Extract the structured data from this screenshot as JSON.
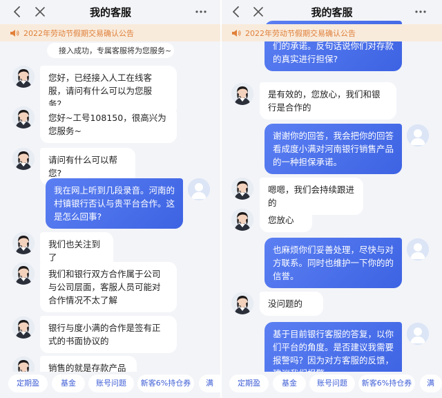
{
  "left": {
    "title": "我的客服",
    "notice": "2022年劳动节假期交易确认公告",
    "system_message": "接入成功，专属客服将为您服务~",
    "messages": [
      {
        "text": "您好，已经接入人工在线客服，请问有什么可以为您服务？"
      },
      {
        "text": "您好~工号108150，很高兴为您服务~"
      },
      {
        "text": "请问有什么可以帮您?"
      },
      {
        "text": "我在网上听到几段录音。河南的村镇银行否认与贵平台合作。这是怎么回事?"
      },
      {
        "text": "我们也关注到了"
      },
      {
        "text": "我们和银行双方合作属于公司与公司层面，客服人员可能对合作情况不太了解"
      },
      {
        "text": "银行与度小满的合作是签有正式的书面协议的"
      },
      {
        "text": "销售的就是存款产品的"
      }
    ],
    "chips": [
      "定期盈",
      "基金",
      "账号问题",
      "新客6%持仓券",
      "满"
    ]
  },
  "right": {
    "title": "我的客服",
    "notice": "2022年劳动节假期交易确认公告",
    "messages": [
      {
        "text": "保险保障是否有效，是否就是你们的承诺。反句话说你们对存款的真实进行担保?"
      },
      {
        "text": "是有效的，您放心，我们和银行是合作的"
      },
      {
        "text": "谢谢你的回答，我会把你的回答看成度小满对河南银行销售产品的一种担保承诺。"
      },
      {
        "text": "嗯嗯，我们会持续跟进的"
      },
      {
        "text": "您放心"
      },
      {
        "text": "也麻烦你们妥善处理，尽快与对方联系。同时也维护一下你的的信誉。"
      },
      {
        "text": "没问题的"
      },
      {
        "text": "基于目前银行客服的答复，以你们平台的角度。是否建议我需要报警吗？因为对方客服的反馈，建议我们报警。"
      }
    ],
    "chips": [
      "定期盈",
      "基金",
      "账号问题",
      "新客6%持仓券",
      "满"
    ]
  },
  "colors": {
    "accent": "#3d63e3",
    "notice_bg": "#f8ebdc",
    "notice_text": "#e0803a",
    "background": "#f3f4f8"
  },
  "icons": {
    "back": "chevron-left-icon",
    "close": "close-icon",
    "more": "more-icon",
    "notice": "speaker-icon",
    "system": "smile-icon"
  }
}
